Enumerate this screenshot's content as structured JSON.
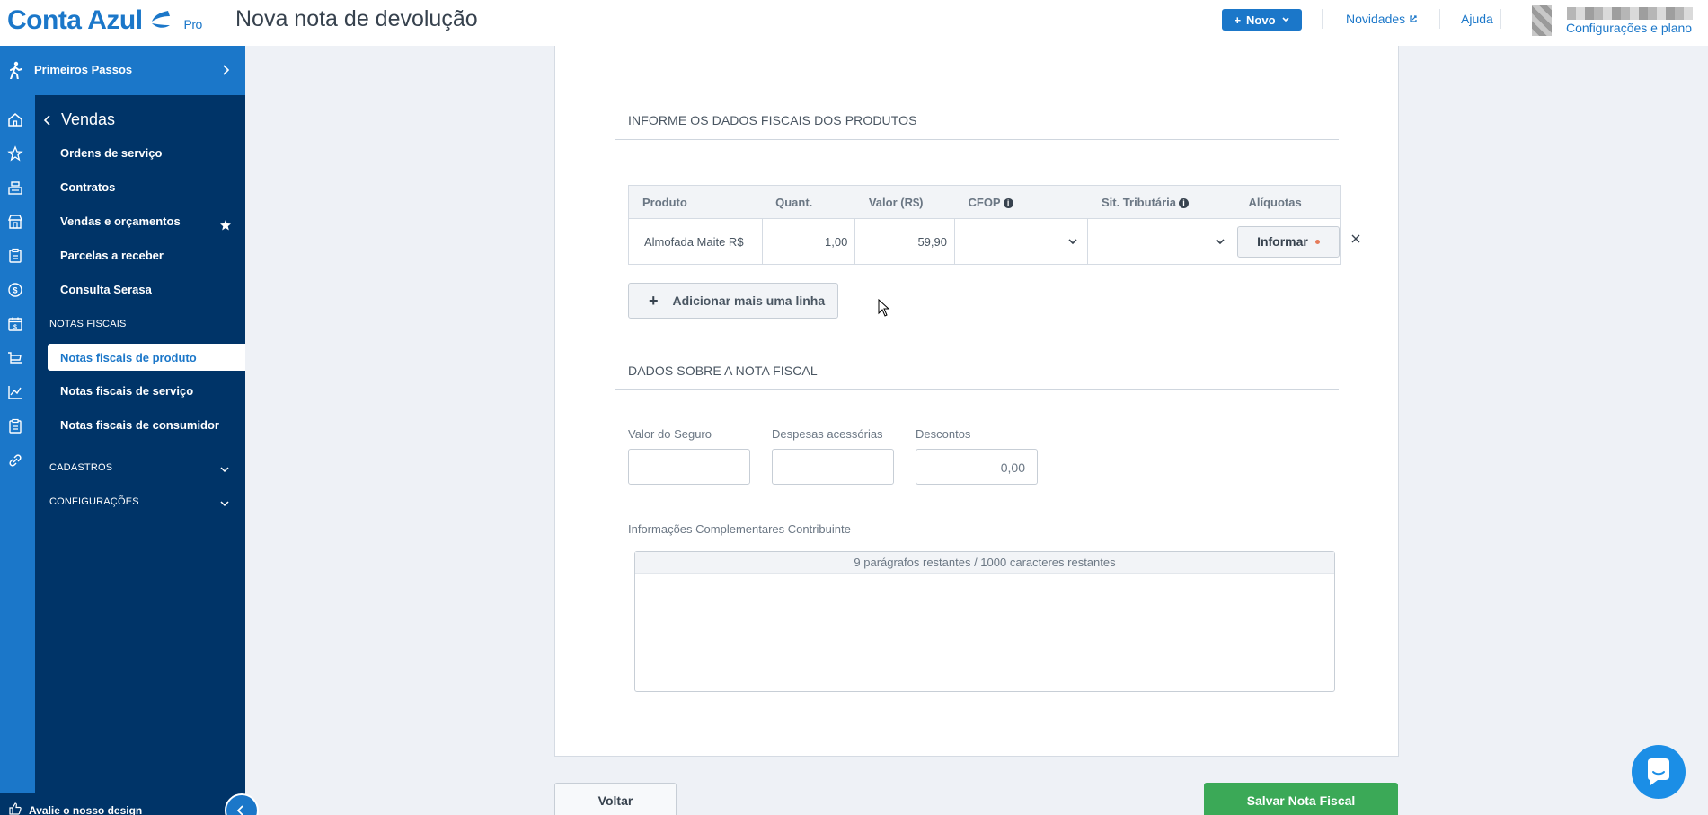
{
  "header": {
    "logo_text": "Conta Azul",
    "logo_badge": "Pro",
    "page_title": "Nova nota de devolução",
    "new_button": "Novo",
    "links": [
      "Novidades",
      "Ajuda"
    ],
    "settings_link": "Configurações e plano"
  },
  "sidebar": {
    "primeiros_passos": "Primeiros Passos",
    "back_label": "Vendas",
    "items": [
      "Ordens de serviço",
      "Contratos",
      "Vendas e orçamentos",
      "Parcelas a receber",
      "Consulta Serasa"
    ],
    "section_notas": "NOTAS FISCAIS",
    "notas_items": [
      "Notas fiscais de produto",
      "Notas fiscais de serviço",
      "Notas fiscais de consumidor"
    ],
    "section_cadastros": "CADASTROS",
    "section_config": "CONFIGURAÇÕES",
    "feedback": "Avalie o nosso design"
  },
  "products_section": {
    "title": "INFORME OS DADOS FISCAIS DOS PRODUTOS",
    "headers": [
      "Produto",
      "Quant.",
      "Valor (R$)",
      "CFOP",
      "Sit. Tributária",
      "Alíquotas"
    ],
    "row": {
      "produto": "Almofada Maite R$",
      "quantidade": "1,00",
      "valor": "59,90",
      "cfop": "",
      "sit_tributaria": "",
      "aliquotas_button": "Informar"
    },
    "add_line_button": "Adicionar mais uma linha"
  },
  "nota_section": {
    "title": "DADOS SOBRE A NOTA FISCAL",
    "seguro_label": "Valor do Seguro",
    "seguro_value": "",
    "despesas_label": "Despesas acessórias",
    "despesas_value": "",
    "descontos_label": "Descontos",
    "descontos_value": "0,00",
    "info_label": "Informações Complementares Contribuinte",
    "info_counter": "9 parágrafos restantes / 1000 caracteres restantes"
  },
  "footer": {
    "back_button": "Voltar",
    "save_button": "Salvar Nota Fiscal"
  },
  "colors": {
    "brand": "#1b77c9",
    "sidebar_dark": "#003468",
    "save_green": "#3ba957"
  }
}
